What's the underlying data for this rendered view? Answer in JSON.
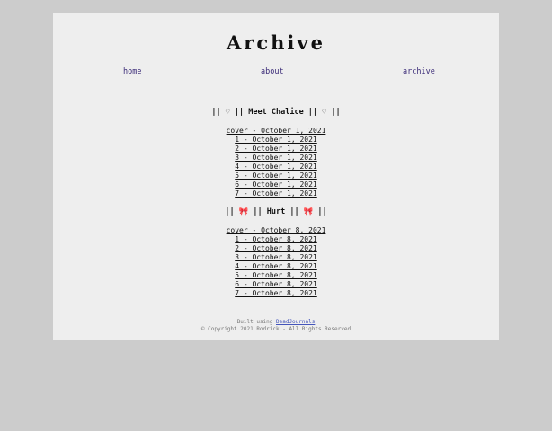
{
  "site": {
    "title": "Archive"
  },
  "nav": {
    "home": "home",
    "about": "about",
    "archive": "archive"
  },
  "sections": [
    {
      "heading": "|| ♡ || Meet Chalice || ♡ ||",
      "entries": [
        "cover - October 1, 2021",
        "1 - October 1, 2021",
        "2 - October 1, 2021",
        "3 - October 1, 2021",
        "4 - October 1, 2021",
        "5 - October 1, 2021",
        "6 - October 1, 2021",
        "7 - October 1, 2021"
      ]
    },
    {
      "heading": "|| 🎀 || Hurt || 🎀 ||",
      "entries": [
        "cover - October 8, 2021",
        "1 - October 8, 2021",
        "2 - October 8, 2021",
        "3 - October 8, 2021",
        "4 - October 8, 2021",
        "5 - October 8, 2021",
        "6 - October 8, 2021",
        "7 - October 8, 2021"
      ]
    }
  ],
  "footer": {
    "built_prefix": "Built using ",
    "built_link": "DeadJournals",
    "copyright": "© Copyright 2021 Rodrick - All Rights Reserved"
  }
}
